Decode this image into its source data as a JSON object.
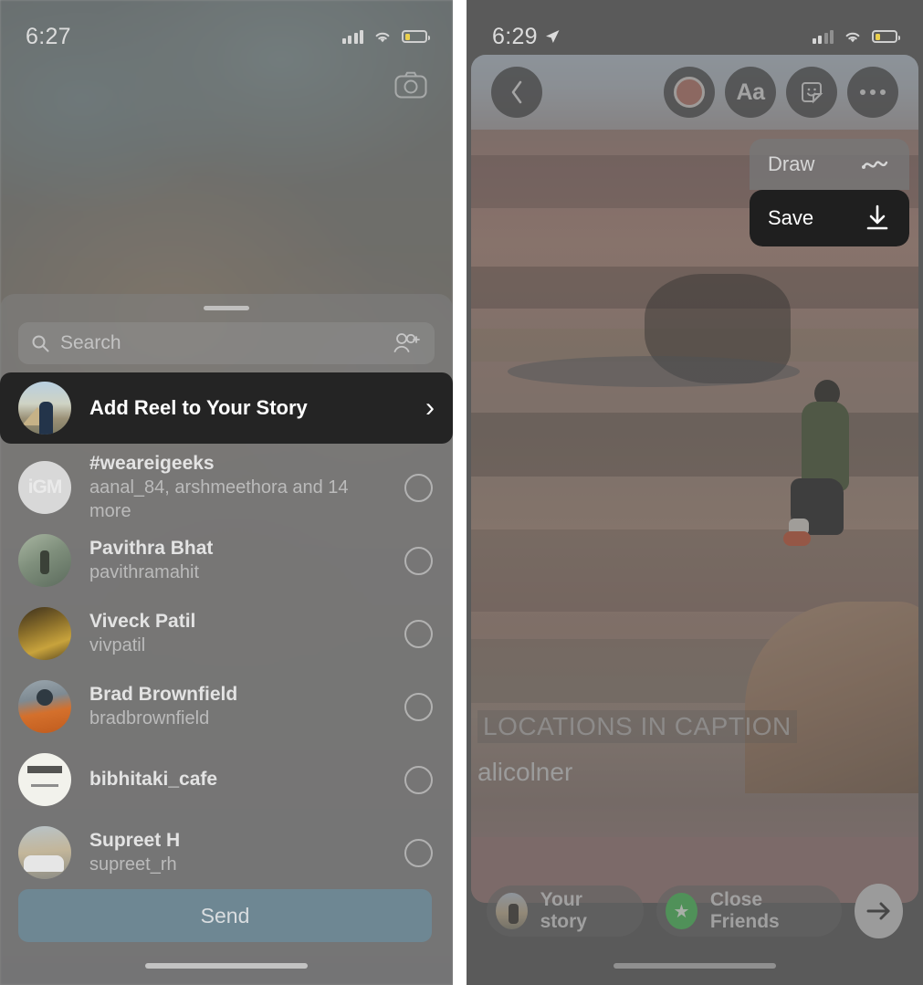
{
  "left_phone": {
    "status": {
      "time": "6:27",
      "battery_level_pct": 26
    },
    "camera_icon": "camera-icon",
    "share_sheet": {
      "search": {
        "placeholder": "Search",
        "icon": "search-icon",
        "trailing_icon": "add-people-icon"
      },
      "highlight_row": {
        "label": "Add Reel to Your Story",
        "avatar": "pyramid-avatar",
        "chevron": "chevron-right-icon"
      },
      "contacts": [
        {
          "name": "#weareigeeks",
          "sub": "aanal_84, arshmeethora and 14 more",
          "avatar": "igm-logo-avatar",
          "selected": false
        },
        {
          "name": "Pavithra Bhat",
          "sub": "pavithramahit",
          "avatar": "pavithra-avatar",
          "selected": false
        },
        {
          "name": "Viveck Patil",
          "sub": "vivpatil",
          "avatar": "viveck-avatar",
          "selected": false
        },
        {
          "name": "Brad Brownfield",
          "sub": "bradbrownfield",
          "avatar": "brad-avatar",
          "selected": false
        },
        {
          "name": "bibhitaki_cafe",
          "sub": "",
          "avatar": "bibhitaki-avatar",
          "selected": false
        },
        {
          "name": "Supreet H",
          "sub": "supreet_rh",
          "avatar": "supreet-avatar",
          "selected": false
        }
      ],
      "send_label": "Send",
      "send_color": "#6e8793"
    }
  },
  "right_phone": {
    "status": {
      "time": "6:29",
      "location_icon": "location-arrow-icon",
      "battery_level_pct": 26
    },
    "toolbar": {
      "back": "chevron-left-icon",
      "actions": [
        {
          "icon": "record-dot-icon",
          "name": "camera-shutter-button"
        },
        {
          "icon": "text-aa-icon",
          "label": "Aa"
        },
        {
          "icon": "sticker-icon"
        },
        {
          "icon": "more-ellipsis-icon"
        }
      ]
    },
    "context_menu": [
      {
        "label": "Draw",
        "icon": "squiggle-draw-icon",
        "highlighted": false
      },
      {
        "label": "Save",
        "icon": "download-arrow-icon",
        "highlighted": true
      }
    ],
    "caption": {
      "location_text": "LOCATIONS IN CAPTION",
      "username": "alicolner"
    },
    "bottom_bar": {
      "your_story_label": "Your story",
      "close_friends_label": "Close Friends",
      "close_friends_color": "#4cc25b",
      "next_icon": "arrow-right-icon"
    }
  }
}
